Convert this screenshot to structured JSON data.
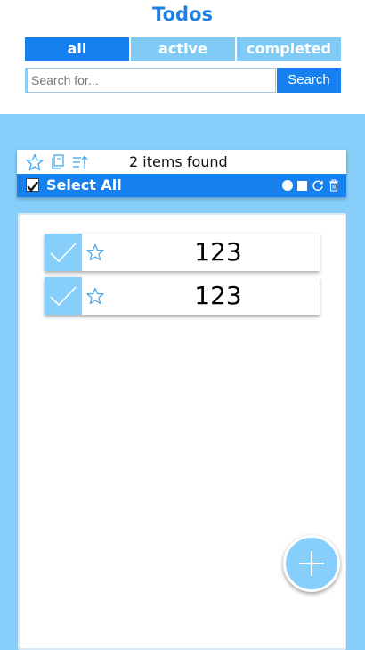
{
  "app": {
    "title": "Todos"
  },
  "filters": {
    "all": "all",
    "active": "active",
    "completed": "completed",
    "selected": "all"
  },
  "search": {
    "placeholder": "Search for...",
    "value": "",
    "button_label": "Search"
  },
  "toolbar": {
    "items_found": "2 items found",
    "select_all_label": "Select All",
    "select_all_checked": true,
    "icons": [
      "star-icon",
      "copy-icon",
      "sort-icon"
    ],
    "bulk_icons": [
      "circle-icon",
      "square-icon",
      "refresh-icon",
      "trash-icon"
    ]
  },
  "todos": [
    {
      "title": "123",
      "completed": true,
      "starred": false
    },
    {
      "title": "123",
      "completed": true,
      "starred": false
    }
  ],
  "colors": {
    "background": "#87cefa",
    "accent": "#1580ee",
    "tab_inactive": "#7fcbf5",
    "title": "#1a80e6"
  }
}
